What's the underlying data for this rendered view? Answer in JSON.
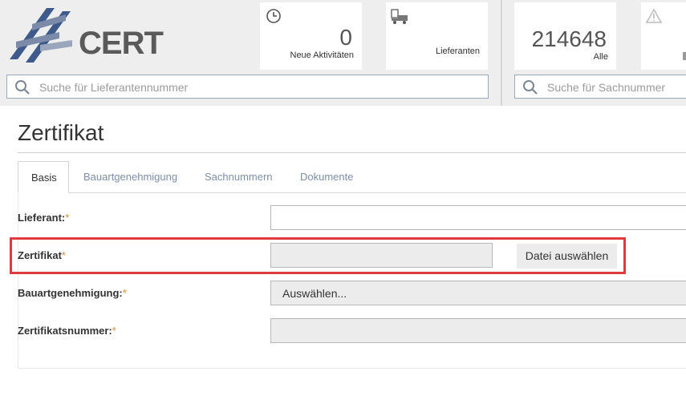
{
  "header": {
    "logo_text": "CERT",
    "tiles": [
      {
        "icon": "clock-icon",
        "count": "0",
        "label": "Neue Aktivitäten"
      },
      {
        "icon": "truck-icon",
        "count": "",
        "label": "Lieferanten"
      },
      {
        "icon": "",
        "count": "214648",
        "label": "Alle"
      },
      {
        "icon": "warning-icon",
        "count": "",
        "label": ""
      }
    ],
    "search_left": {
      "placeholder": "Suche für Lieferantennummer"
    },
    "search_right": {
      "placeholder": "Suche für Sachnummer"
    }
  },
  "page": {
    "title": "Zertifikat",
    "tabs": [
      {
        "label": "Basis",
        "active": true
      },
      {
        "label": "Bauartgenehmigung",
        "active": false
      },
      {
        "label": "Sachnummern",
        "active": false
      },
      {
        "label": "Dokumente",
        "active": false
      }
    ]
  },
  "form": {
    "lieferant": {
      "label": "Lieferant:",
      "required": "*",
      "value": ""
    },
    "zertifikat": {
      "label": "Zertifikat",
      "required": "*",
      "value": "",
      "button": "Datei auswählen"
    },
    "bauartgenehmigung": {
      "label": "Bauartgenehmigung:",
      "required": "*",
      "value": "Auswählen..."
    },
    "zertifikatsnummer": {
      "label": "Zertifikatsnummer:",
      "required": "*",
      "value": ""
    }
  },
  "colors": {
    "accent_required": "#e08a2a",
    "highlight": "#e0393e",
    "tab_inactive": "#7d8fa6"
  }
}
